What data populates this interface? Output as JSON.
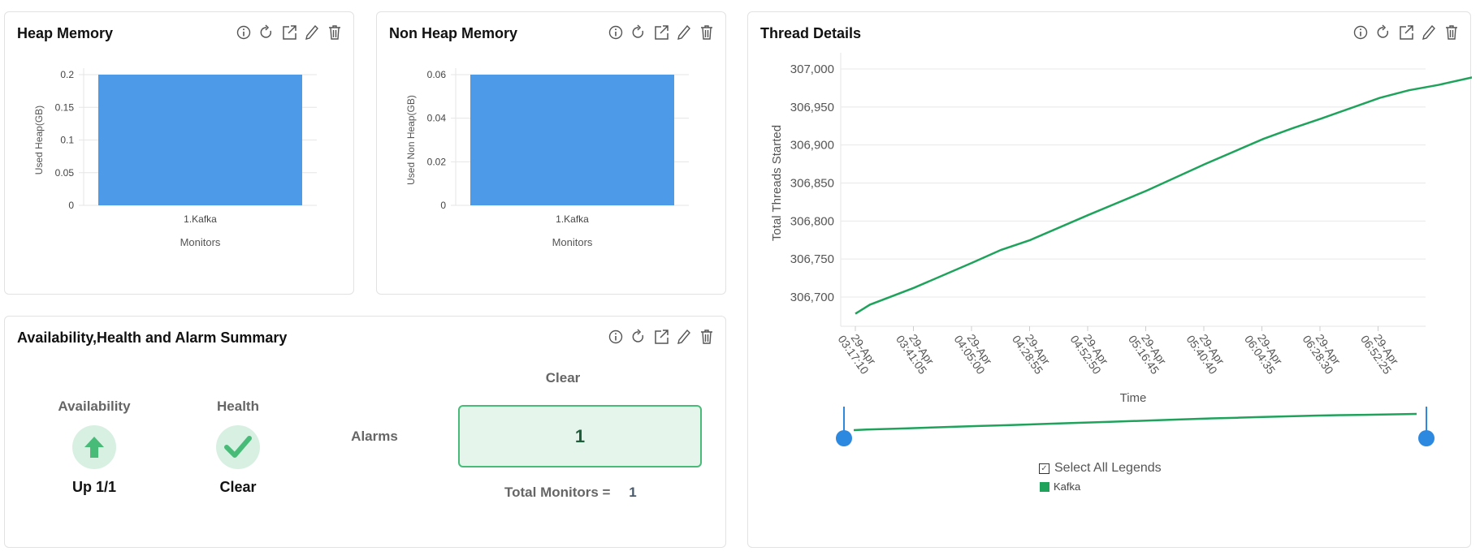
{
  "panels": {
    "heap": {
      "title": "Heap Memory"
    },
    "nonheap": {
      "title": "Non Heap Memory"
    },
    "summary": {
      "title": "Availability,Health and Alarm Summary"
    },
    "thread": {
      "title": "Thread Details"
    }
  },
  "summary": {
    "availability_label": "Availability",
    "availability_value": "Up 1/1",
    "health_label": "Health",
    "health_value": "Clear",
    "alarms_label": "Alarms",
    "alarm_status": "Clear",
    "alarm_count": "1",
    "total_monitors_label": "Total Monitors =",
    "total_monitors_value": "1",
    "colors": {
      "green": "#48bb78",
      "green_bg": "#e6f5ec"
    }
  },
  "legend": {
    "select_all": "Select All Legends",
    "items": [
      "Kafka"
    ]
  },
  "chart_data": [
    {
      "type": "bar",
      "title": "Heap Memory",
      "categories": [
        "1.Kafka"
      ],
      "values": [
        0.2
      ],
      "xlabel": "Monitors",
      "ylabel": "Used Heap(GB)",
      "ylim": [
        0,
        0.2
      ],
      "yticks": [
        "0",
        "0.05",
        "0.1",
        "0.15",
        "0.2"
      ],
      "color": "#4d9be8"
    },
    {
      "type": "bar",
      "title": "Non Heap Memory",
      "categories": [
        "1.Kafka"
      ],
      "values": [
        0.06
      ],
      "xlabel": "Monitors",
      "ylabel": "Used Non Heap(GB)",
      "ylim": [
        0,
        0.06
      ],
      "yticks": [
        "0",
        "0.02",
        "0.04",
        "0.06"
      ],
      "color": "#4d9be8"
    },
    {
      "type": "line",
      "title": "Thread Details",
      "xlabel": "Time",
      "ylabel": "Total Threads Started",
      "ylim": [
        306660,
        307010
      ],
      "yticks": [
        "306,700",
        "306,750",
        "306,800",
        "306,850",
        "306,900",
        "306,950",
        "307,000"
      ],
      "ytick_values": [
        306700,
        306750,
        306800,
        306850,
        306900,
        306950,
        307000
      ],
      "xticks": [
        [
          "29-Apr",
          "03:17:10"
        ],
        [
          "29-Apr",
          "03:41:05"
        ],
        [
          "29-Apr",
          "04:05:00"
        ],
        [
          "29-Apr",
          "04:28:55"
        ],
        [
          "29-Apr",
          "04:52:50"
        ],
        [
          "29-Apr",
          "05:16:45"
        ],
        [
          "29-Apr",
          "05:40:40"
        ],
        [
          "29-Apr",
          "06:04:35"
        ],
        [
          "29-Apr",
          "06:28:30"
        ],
        [
          "29-Apr",
          "06:52:25"
        ]
      ],
      "series": [
        {
          "name": "Kafka",
          "color": "#1fa35c",
          "x_minutes": [
            0,
            6,
            24,
            48,
            60,
            72,
            96,
            120,
            144,
            168,
            180,
            192,
            216,
            228,
            240,
            264
          ],
          "values": [
            306678,
            306690,
            306712,
            306745,
            306762,
            306775,
            306808,
            306840,
            306875,
            306908,
            306922,
            306935,
            306962,
            306972,
            306979,
            306996
          ]
        }
      ]
    }
  ]
}
